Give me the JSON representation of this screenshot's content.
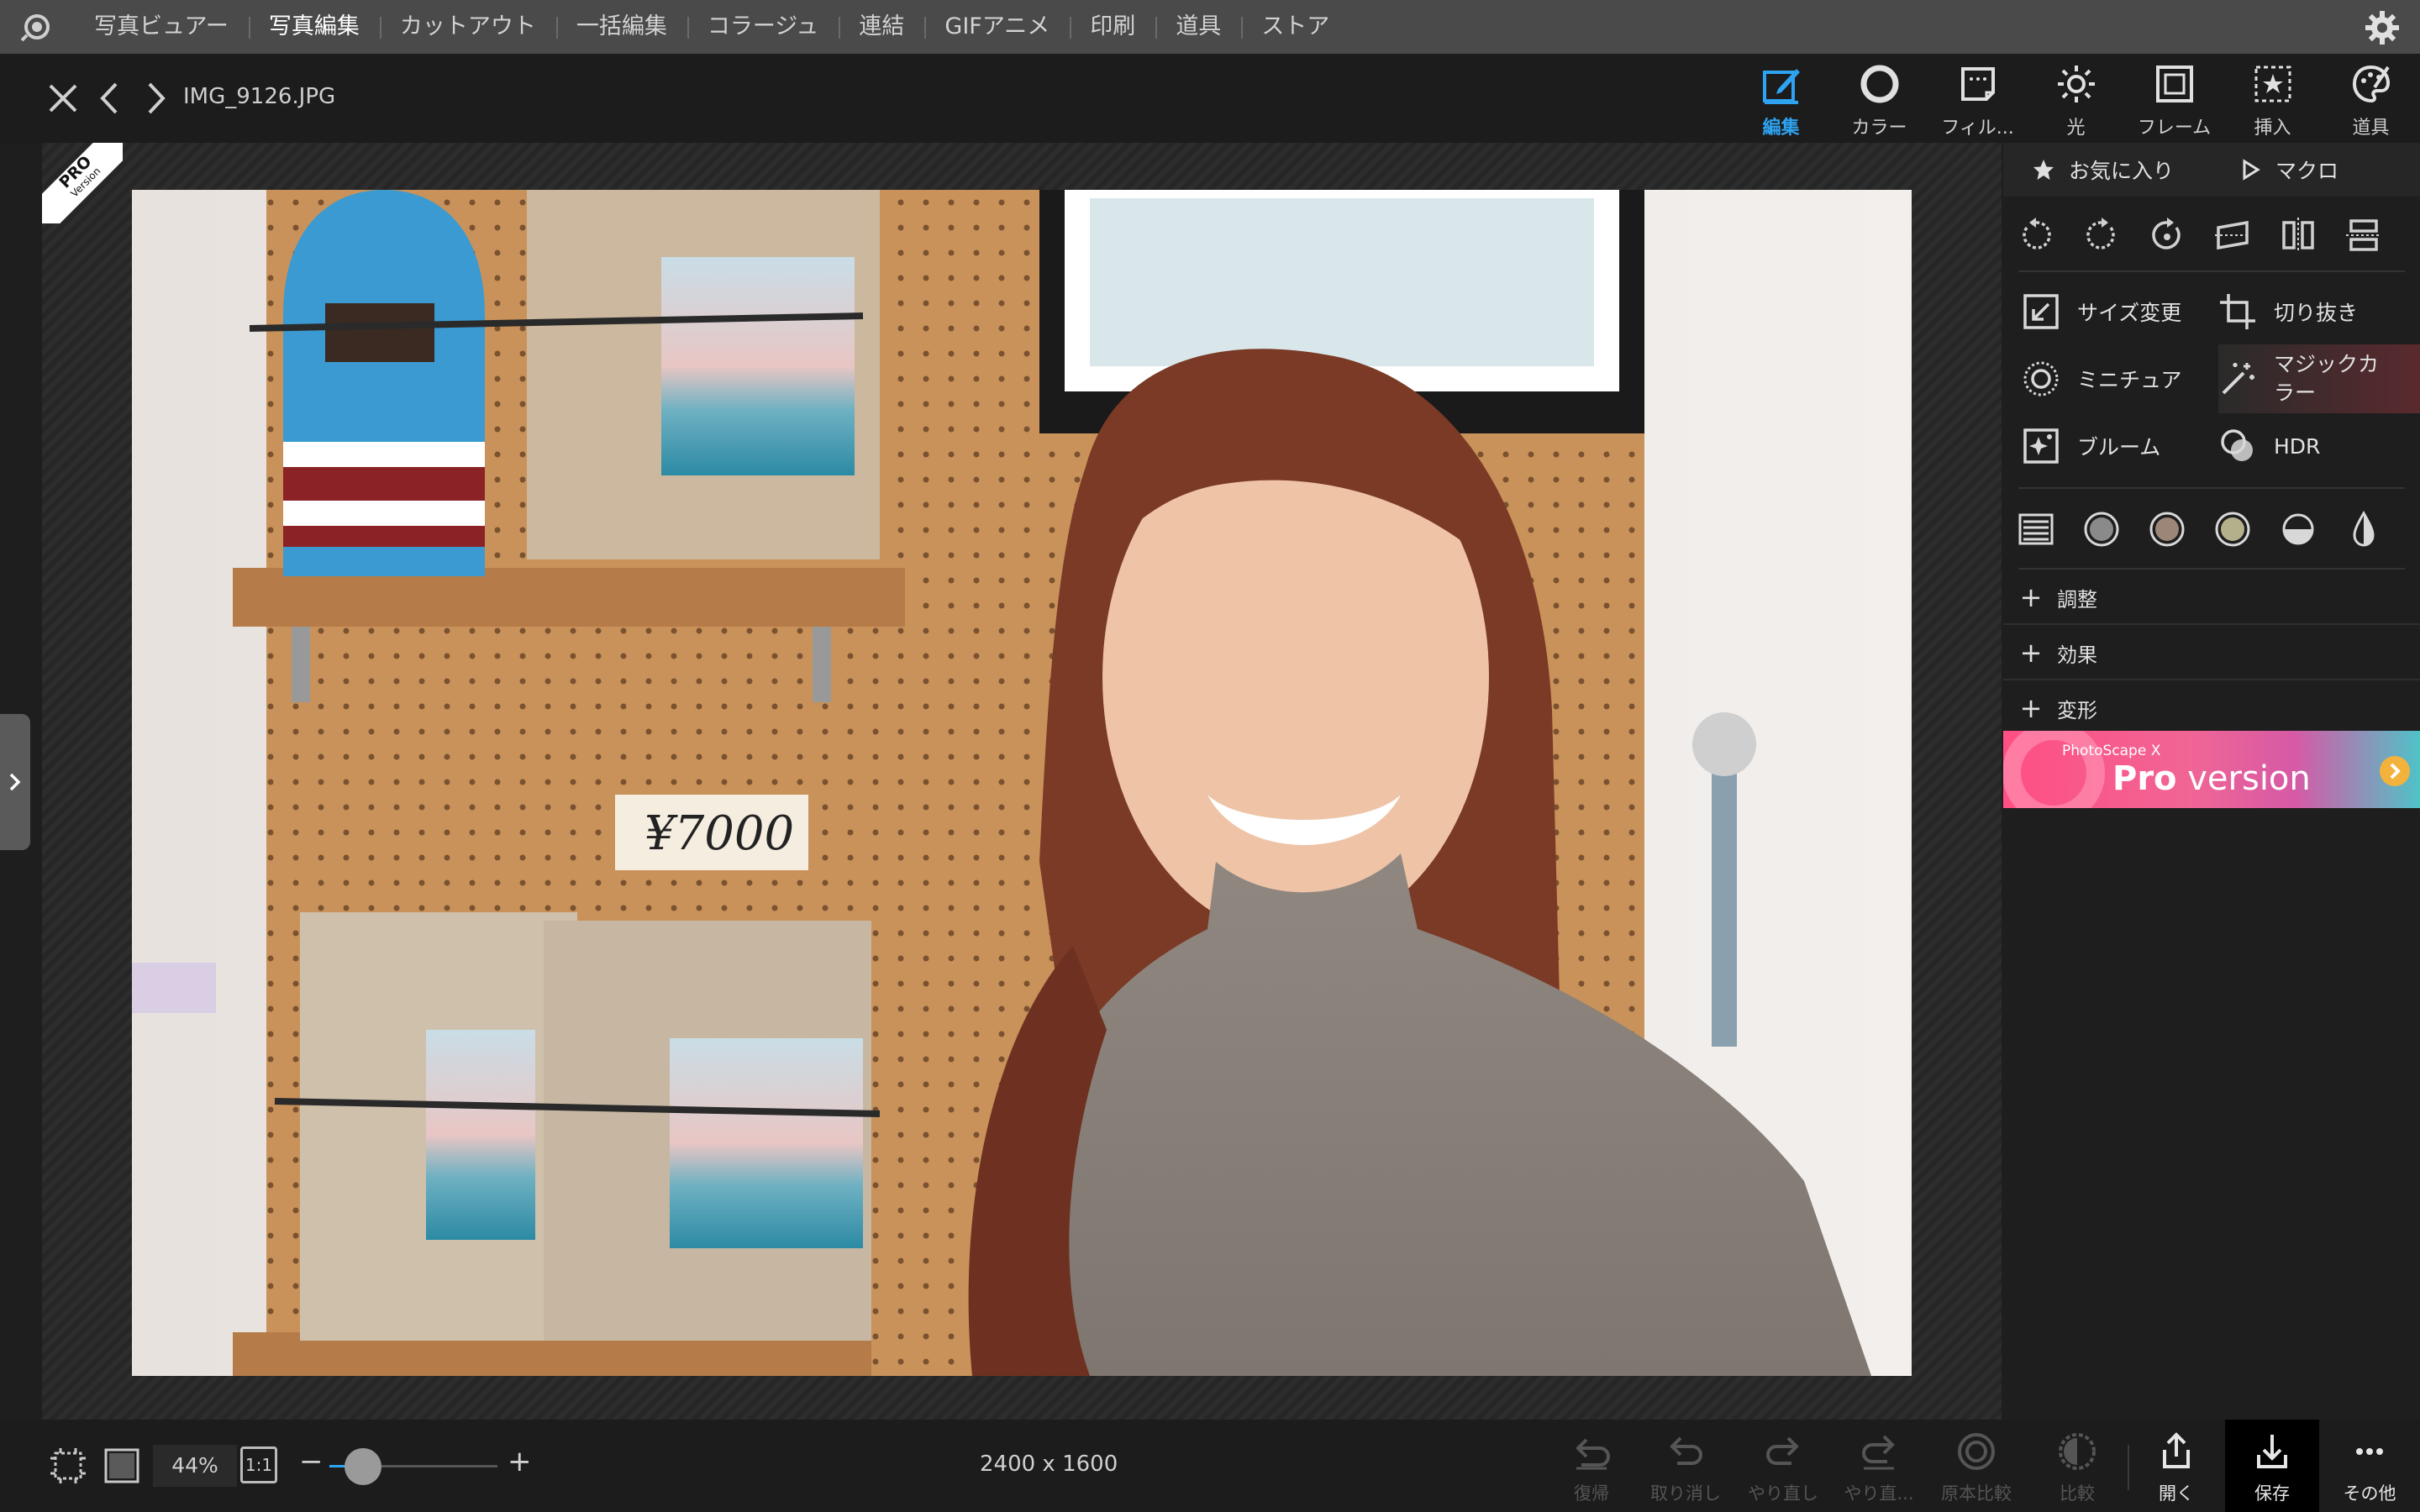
{
  "menu": {
    "items": [
      "写真ビュアー",
      "写真編集",
      "カットアウト",
      "一括編集",
      "コラージュ",
      "連結",
      "GIFアニメ",
      "印刷",
      "道具",
      "ストア"
    ],
    "active_index": 1
  },
  "header": {
    "filename": "IMG_9126.JPG",
    "tabs": [
      "編集",
      "カラー",
      "フィル...",
      "光",
      "フレーム",
      "挿入",
      "道具"
    ],
    "active_tab": "編集"
  },
  "badge": {
    "pro": "PRO",
    "version": "Version"
  },
  "panel": {
    "favorites_label": "お気に入り",
    "macro_label": "マクロ",
    "tools": {
      "resize": "サイズ変更",
      "crop": "切り抜き",
      "miniature": "ミニチュア",
      "magic_color_line1": "マジックカ",
      "magic_color_line2": "ラー",
      "bloom": "ブルーム",
      "hdr": "HDR"
    },
    "sections": [
      "調整",
      "効果",
      "変形"
    ],
    "banner_small": "PhotoScape X",
    "banner_pro": "Pro",
    "banner_version": " version"
  },
  "photo": {
    "price_tag": "¥7000"
  },
  "bottom": {
    "zoom": "44%",
    "one_to_one": "1:1",
    "minus": "−",
    "plus": "+",
    "dimensions": "2400 x 1600",
    "actions": [
      "復帰",
      "取り消し",
      "やり直し",
      "やり直...",
      "原本比較",
      "比較",
      "開く",
      "保存",
      "その他"
    ]
  },
  "colors": {
    "accent": "#2ea3f2",
    "topbar": "#4a4a4a",
    "panel": "#1e1e1e"
  }
}
